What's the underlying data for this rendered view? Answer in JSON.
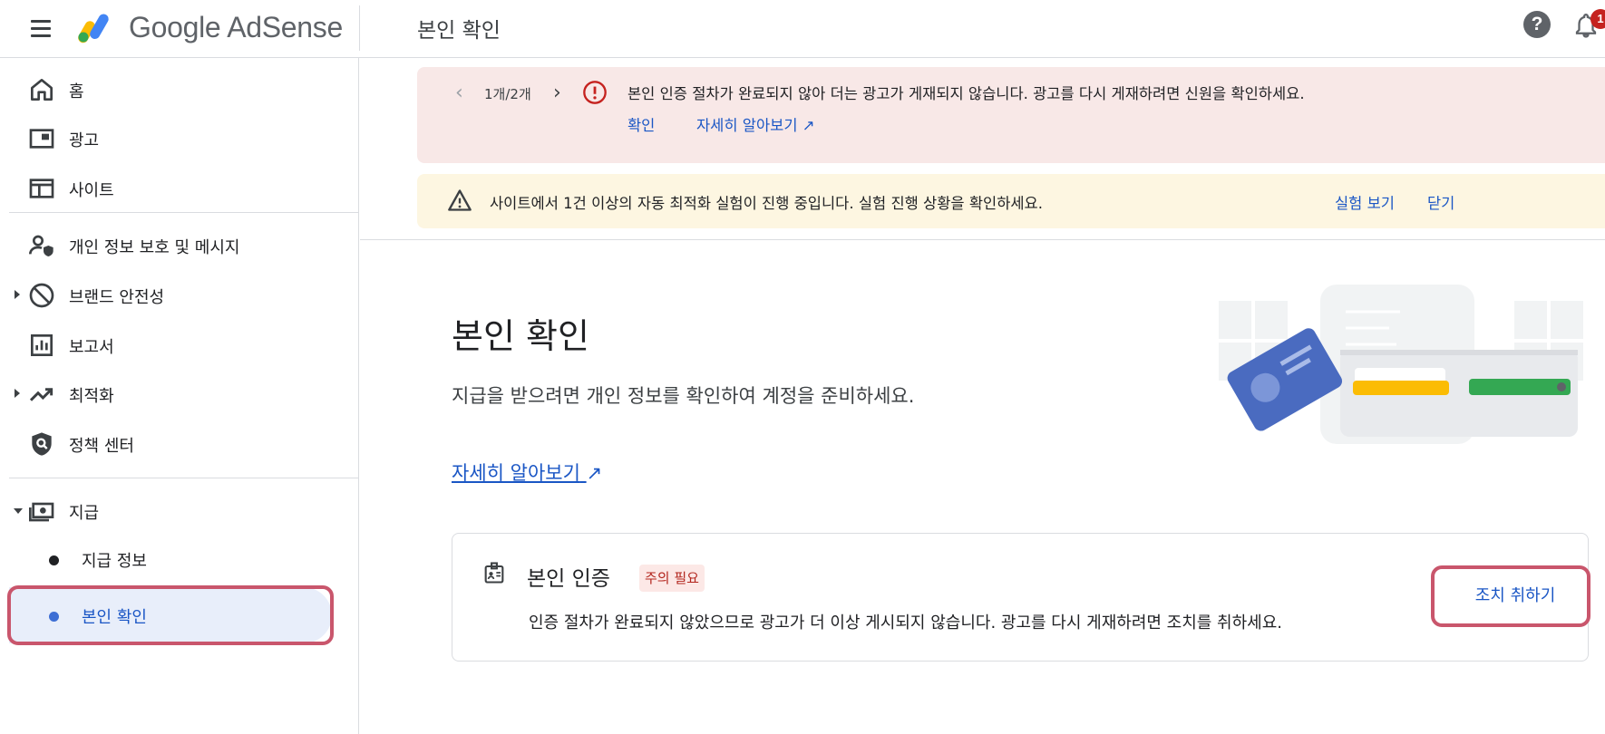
{
  "header": {
    "brand": "Google AdSense",
    "page_title": "본인 확인",
    "notification_count": "1"
  },
  "sidebar": {
    "items": [
      {
        "label": "홈",
        "icon": "home-icon"
      },
      {
        "label": "광고",
        "icon": "ads-icon"
      },
      {
        "label": "사이트",
        "icon": "sites-icon"
      },
      {
        "label": "개인 정보 보호 및 메시지",
        "icon": "privacy-messaging-icon"
      },
      {
        "label": "브랜드 안전성",
        "icon": "block-icon"
      },
      {
        "label": "보고서",
        "icon": "reports-icon"
      },
      {
        "label": "최적화",
        "icon": "trending-up-icon"
      },
      {
        "label": "정책 센터",
        "icon": "policy-shield-icon"
      },
      {
        "label": "지급",
        "icon": "payments-icon"
      }
    ],
    "sub_items": [
      {
        "label": "지급 정보",
        "active": false
      },
      {
        "label": "본인 확인",
        "active": true
      }
    ]
  },
  "alerts": {
    "red": {
      "pager": "1개/2개",
      "message": "본인 인증 절차가 완료되지 않아 더는 광고가 게재되지 않습니다. 광고를 다시 게재하려면 신원을 확인하세요.",
      "confirm_label": "확인",
      "learn_more_label": "자세히 알아보기"
    },
    "yellow": {
      "message": "사이트에서 1건 이상의 자동 최적화 실험이 진행 중입니다. 실험 진행 상황을 확인하세요.",
      "view_label": "실험 보기",
      "close_label": "닫기"
    }
  },
  "main": {
    "title": "본인 확인",
    "description": "지급을 받으려면 개인 정보를 확인하여 계정을 준비하세요.",
    "learn_more": "자세히 알아보기",
    "card": {
      "title": "본인 인증",
      "status_chip": "주의 필요",
      "text": "인증 절차가 완료되지 않았으므로 광고가 더 이상 게시되지 않습니다. 광고를 다시 게재하려면 조치를 취하세요.",
      "action_label": "조치 취하기"
    }
  },
  "colors": {
    "accent": "#1a56c5",
    "error": "#c5221f",
    "highlight": "#c9566c",
    "red_banner": "#f8e8e7",
    "yellow_banner": "#fdf6e1"
  }
}
